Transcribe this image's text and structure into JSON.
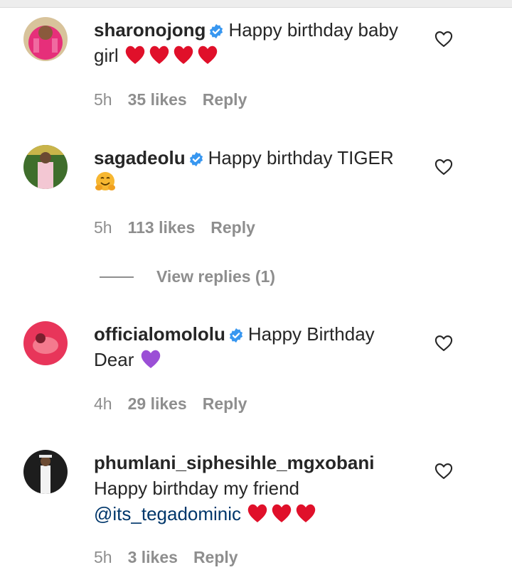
{
  "comments": [
    {
      "username": "sharonojong",
      "verified": true,
      "text": "Happy birthday baby girl",
      "emoji": "❤️❤️❤️❤️",
      "time": "5h",
      "likes": "35 likes",
      "reply": "Reply"
    },
    {
      "username": "sagadeolu",
      "verified": true,
      "text": "Happy birthday TIGER",
      "emoji": "🤗",
      "time": "5h",
      "likes": "113 likes",
      "reply": "Reply",
      "view_replies": "View replies (1)"
    },
    {
      "username": "officialomololu",
      "verified": true,
      "text": "Happy Birthday Dear",
      "emoji": "💜",
      "time": "4h",
      "likes": "29 likes",
      "reply": "Reply"
    },
    {
      "username": "phumlani_siphesihle_mgxobani",
      "verified": false,
      "text": "Happy birthday my friend",
      "mention": "@its_tegadominic",
      "emoji": "❤️❤️❤️",
      "time": "5h",
      "likes": "3 likes",
      "reply": "Reply"
    }
  ],
  "colors": {
    "text": "#262626",
    "meta": "#8e8e8e",
    "verified": "#3897f0",
    "mention": "#00376b",
    "heart_emoji": "#e0102a",
    "purple_heart_emoji": "#9b4fd6"
  },
  "icons": {
    "like": "heart-outline-icon",
    "verified": "verified-badge-icon"
  }
}
